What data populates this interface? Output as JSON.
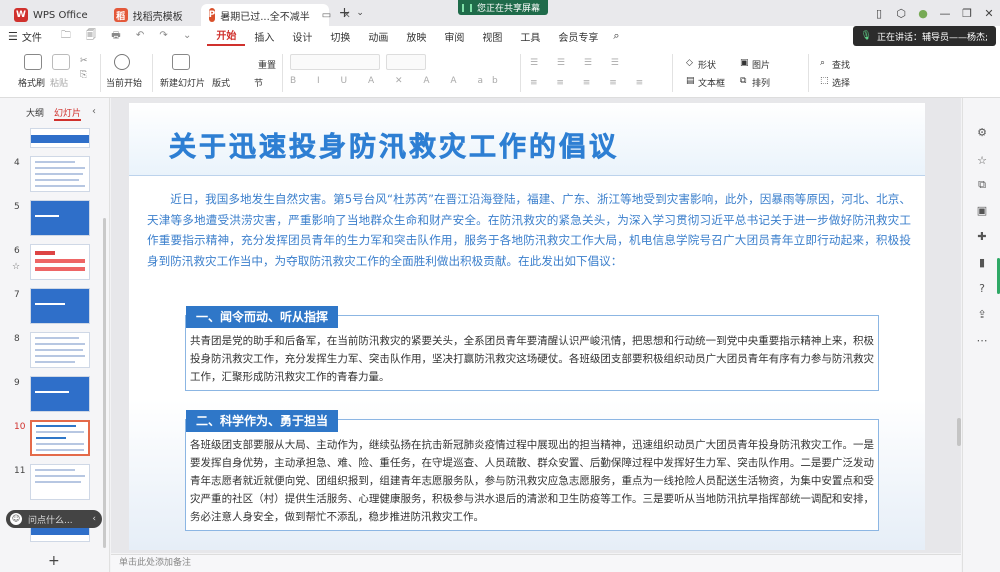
{
  "titlebar": {
    "tabs": [
      {
        "label": "WPS Office",
        "icon": "wps-icon",
        "color": "#d0312d"
      },
      {
        "label": "找稻壳模板",
        "icon": "docer-icon",
        "color": "#e3583a"
      },
      {
        "label": "暑期已过...全不减半",
        "icon": "ppt-icon",
        "color": "#d9502b",
        "active": true
      }
    ],
    "share_banner": "您正在共享屏幕",
    "speaking_label": "正在讲话：",
    "speaking_name": "辅导员——杨杰;"
  },
  "menubar": {
    "items": [
      "文件",
      "开始",
      "插入",
      "设计",
      "切换",
      "动画",
      "放映",
      "审阅",
      "视图",
      "工具",
      "会员专享"
    ],
    "active": "开始"
  },
  "ribbon": {
    "format_painter": "格式刷",
    "paste": "粘贴",
    "play_from_current": "当前开始",
    "new_slide": "新建幻灯片",
    "layout": "版式",
    "section": "节",
    "reset": "重置",
    "shape": "形状",
    "picture": "图片",
    "textbox": "文本框",
    "arrange": "排列",
    "find": "查找",
    "select": "选择"
  },
  "sidebar": {
    "tab_outline": "大纲",
    "tab_slides": "幻灯片",
    "slide_numbers": [
      "4",
      "5",
      "6",
      "7",
      "8",
      "9",
      "10",
      "11"
    ],
    "selected": "10",
    "chat_placeholder": "问点什么...",
    "add_slide": "+"
  },
  "slide": {
    "title": "关于迅速投身防汛救灾工作的倡议",
    "intro": "近日，我国多地发生自然灾害。第5号台风“杜苏芮”在晋江沿海登陆，福建、广东、浙江等地受到灾害影响，此外，因暴雨等原因，河北、北京、天津等多地遭受洪涝灾害，严重影响了当地群众生命和财产安全。在防汛救灾的紧急关头，为深入学习贯彻习近平总书记关于进一步做好防汛救灾工作重要指示精神，充分发挥团员青年的生力军和突击队作用，服务于各地防汛救灾工作大局，机电信息学院号召广大团员青年立即行动起来，积极投身到防汛救灾工作当中，为夺取防汛救灾工作的全面胜利做出积极贡献。在此发出如下倡议：",
    "sections": [
      {
        "heading": "一、闻令而动、听从指挥",
        "body": "共青团是党的助手和后备军，在当前防汛救灾的紧要关头，全系团员青年要清醒认识严峻汛情，把思想和行动统一到党中央重要指示精神上来，积极投身防汛救灾工作，充分发挥生力军、突击队作用，坚决打赢防汛救灾这场硬仗。各班级团支部要积极组织动员广大团员青年有序有力参与防汛救灾工作，汇聚形成防汛救灾工作的青春力量。"
      },
      {
        "heading": "二、科学作为、勇于担当",
        "body": "各班级团支部要服从大局、主动作为，继续弘扬在抗击新冠肺炎疫情过程中展现出的担当精神，迅速组织动员广大团员青年投身防汛救灾工作。一是要发挥自身优势，主动承担急、难、险、重任务，在守堤巡查、人员疏散、群众安置、后勤保障过程中发挥好生力军、突击队作用。二是要广泛发动青年志愿者就近就便向党、团组织报到，组建青年志愿服务队，参与防汛救灾应急志愿服务，重点为一线抢险人员配送生活物资，为集中安置点和受灾严重的社区（村）提供生活服务、心理健康服务，积极参与洪水退后的清淤和卫生防疫等工作。三是要听从当地防汛抗旱指挥部统一调配和安排，务必注意人身安全，做到帮忙不添乱，稳步推进防汛救灾工作。"
      }
    ]
  },
  "notes_placeholder": "单击此处添加备注",
  "colors": {
    "accent": "#d0312d",
    "slide_blue": "#2f77c8",
    "title_blue": "#2e7fd3"
  }
}
